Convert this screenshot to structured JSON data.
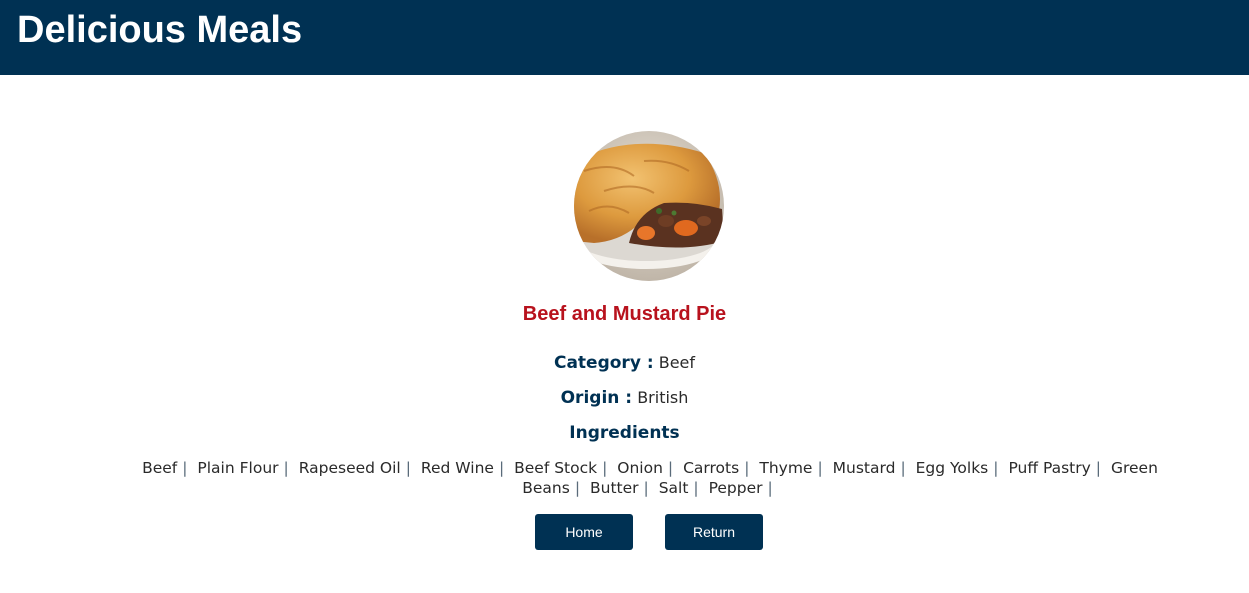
{
  "header": {
    "title": "Delicious Meals"
  },
  "meal": {
    "name": "Beef and Mustard Pie",
    "image_icon": "beef-and-mustard-pie-photo",
    "category_label": "Category :",
    "category": "Beef",
    "origin_label": "Origin :",
    "origin": "British",
    "ingredients_heading": "Ingredients",
    "ingredients": [
      "Beef",
      "Plain Flour",
      "Rapeseed Oil",
      "Red Wine",
      "Beef Stock",
      "Onion",
      "Carrots",
      "Thyme",
      "Mustard",
      "Egg Yolks",
      "Puff Pastry",
      "Green Beans",
      "Butter",
      "Salt",
      "Pepper"
    ]
  },
  "buttons": {
    "home_label": "Home",
    "return_label": "Return"
  },
  "colors": {
    "header_bg": "#003153",
    "title_red": "#b8121d",
    "label_navy": "#003153"
  }
}
